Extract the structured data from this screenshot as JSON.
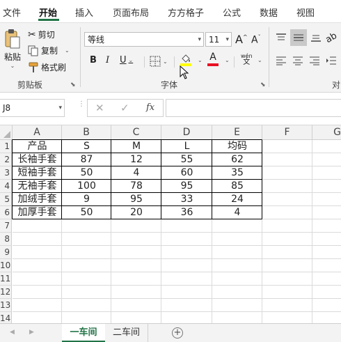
{
  "tabs": [
    "文件",
    "开始",
    "插入",
    "页面布局",
    "方方格子",
    "公式",
    "数据",
    "视图"
  ],
  "ribbon": {
    "clipboard": {
      "paste_label": "粘贴",
      "cut_label": "剪切",
      "copy_label": "复制",
      "format_painter_label": "格式刷",
      "group_label": "剪贴板"
    },
    "font": {
      "font_name": "等线",
      "font_size": "11",
      "bold": "B",
      "italic": "I",
      "underline": "U",
      "wen_label": "wén",
      "wen_char": "文",
      "group_label": "字体",
      "fill_color": "#ffff00",
      "font_color": "#e81123"
    },
    "alignment": {
      "group_label": "对"
    }
  },
  "formula_bar": {
    "name_box": "J8",
    "fx": "fx",
    "content": ""
  },
  "sheet": {
    "columns": [
      "A",
      "B",
      "C",
      "D",
      "E",
      "F",
      "G"
    ],
    "rows": [
      "1",
      "2",
      "3",
      "4",
      "5",
      "6",
      "7",
      "8",
      "9",
      "10",
      "11",
      "12",
      "13",
      "14"
    ],
    "table": [
      [
        "产品",
        "S",
        "M",
        "L",
        "均码"
      ],
      [
        "长袖手套",
        "87",
        "12",
        "55",
        "62"
      ],
      [
        "短袖手套",
        "50",
        "4",
        "60",
        "35"
      ],
      [
        "无袖手套",
        "100",
        "78",
        "95",
        "85"
      ],
      [
        "加绒手套",
        "9",
        "95",
        "33",
        "24"
      ],
      [
        "加厚手套",
        "50",
        "20",
        "36",
        "4"
      ]
    ]
  },
  "sheet_tabs": {
    "active": "一车间",
    "other": "二车间",
    "add": "+"
  },
  "colors": {
    "accent": "#217346"
  }
}
